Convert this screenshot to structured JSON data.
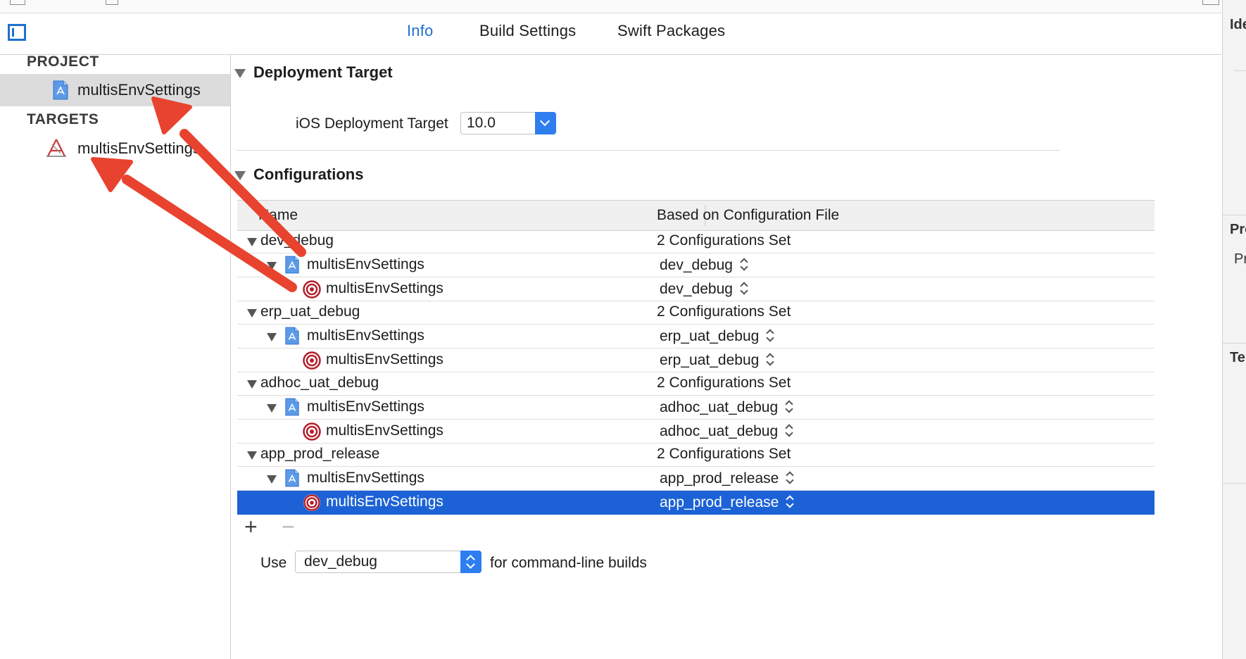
{
  "tabs": [
    {
      "label": "Info",
      "active": true
    },
    {
      "label": "Build Settings",
      "active": false
    },
    {
      "label": "Swift Packages",
      "active": false
    }
  ],
  "navigator": {
    "project_header": "PROJECT",
    "project_item": "multisEnvSettings",
    "targets_header": "TARGETS",
    "target_item": "multisEnvSettings"
  },
  "deployment": {
    "title": "Deployment Target",
    "label": "iOS Deployment Target",
    "value": "10.0"
  },
  "configurations": {
    "title": "Configurations",
    "columns": [
      "Name",
      "Based on Configuration File"
    ],
    "rows": [
      {
        "name": "dev_debug",
        "value": "2 Configurations Set"
      },
      {
        "name": "multisEnvSettings",
        "value": "dev_debug"
      },
      {
        "name": "multisEnvSettings",
        "value": "dev_debug"
      },
      {
        "name": "erp_uat_debug",
        "value": "2 Configurations Set"
      },
      {
        "name": "multisEnvSettings",
        "value": "erp_uat_debug"
      },
      {
        "name": "multisEnvSettings",
        "value": "erp_uat_debug"
      },
      {
        "name": "adhoc_uat_debug",
        "value": "2 Configurations Set"
      },
      {
        "name": "multisEnvSettings",
        "value": "adhoc_uat_debug"
      },
      {
        "name": "multisEnvSettings",
        "value": "adhoc_uat_debug"
      },
      {
        "name": "app_prod_release",
        "value": "2 Configurations Set"
      },
      {
        "name": "multisEnvSettings",
        "value": "app_prod_release"
      },
      {
        "name": "multisEnvSettings",
        "value": "app_prod_release"
      }
    ],
    "add_label": "+",
    "remove_label": "−"
  },
  "command_line": {
    "prefix": "Use",
    "value": "dev_debug",
    "suffix": "for command-line builds"
  },
  "inspector": {
    "label_1": "Ide",
    "label_2": "Pro",
    "label_3": "Pr",
    "label_4": "Te"
  },
  "colors": {
    "accent": "#1f6fd1",
    "selection": "#1c62d6",
    "annotation_arrow": "#e8432e",
    "target_icon": "#b3202a"
  }
}
